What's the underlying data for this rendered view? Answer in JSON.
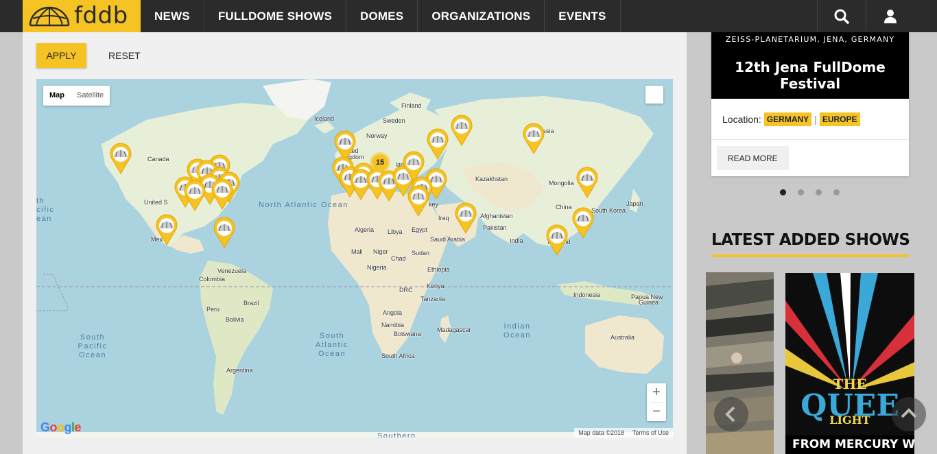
{
  "brand": {
    "name": "fddb",
    "accent_color": "#f6c324"
  },
  "nav": {
    "items": [
      "NEWS",
      "FULLDOME SHOWS",
      "DOMES",
      "ORGANIZATIONS",
      "EVENTS"
    ],
    "search_icon": "search-icon",
    "user_icon": "user-icon"
  },
  "filters": {
    "apply_label": "APPLY",
    "reset_label": "RESET"
  },
  "map": {
    "type_buttons": [
      "Map",
      "Satellite"
    ],
    "active_type": "Map",
    "zoom_in": "+",
    "zoom_out": "−",
    "cluster_count": "15",
    "attribution": [
      "Map data ©2018",
      "Terms of Use"
    ],
    "google_logo": [
      "G",
      "o",
      "o",
      "g",
      "l",
      "e"
    ],
    "country_labels": [
      "Finland",
      "Sweden",
      "Iceland",
      "Norway",
      "ted",
      "gdom",
      "land",
      "Russia",
      "Kazakhstan",
      "Mongolia",
      "Canada",
      "United S",
      "Mex",
      "Venezuela",
      "Colombia",
      "Brazil",
      "Bolivia",
      "Peru",
      "Argentina",
      "Algeria",
      "Libya",
      "Egypt",
      "Iraq",
      "Mali",
      "Niger",
      "Chad",
      "Sudan",
      "Nigeria",
      "Ethiopia",
      "Kenya",
      "DRC",
      "Tanzania",
      "Angola",
      "Namibia",
      "Botswana",
      "South Africa",
      "Madagascar",
      "Saudi Arabia",
      "Afghanistan",
      "Pakistan",
      "India",
      "China",
      "South Korea",
      "Japan",
      "Thailand",
      "Indonesia",
      "Papua New",
      "Guinea",
      "Australia",
      "key",
      "pai",
      "ly"
    ],
    "ocean_labels": [
      "North Atlantic Ocean",
      "South Atlantic Ocean",
      "Indian Ocean",
      "South Pacific Ocean",
      "th cific ean",
      "Southern"
    ],
    "marker_icon": "dome-marker-icon"
  },
  "event": {
    "venue": "ZEISS-PLANETARIUM, JENA, GERMANY",
    "title": "12th Jena FullDome Festival",
    "location_label": "Location:",
    "tags": [
      "GERMANY",
      "EUROPE"
    ],
    "separator": "|",
    "read_more": "READ MORE"
  },
  "carousel": {
    "slides": 4,
    "active_index": 0
  },
  "latest_shows": {
    "title": "LATEST ADDED SHOWS",
    "show2": {
      "line1": "THE",
      "line2": "QUEE",
      "line3": "LIGHT",
      "subtitle": "FROM MERCURY W"
    }
  }
}
